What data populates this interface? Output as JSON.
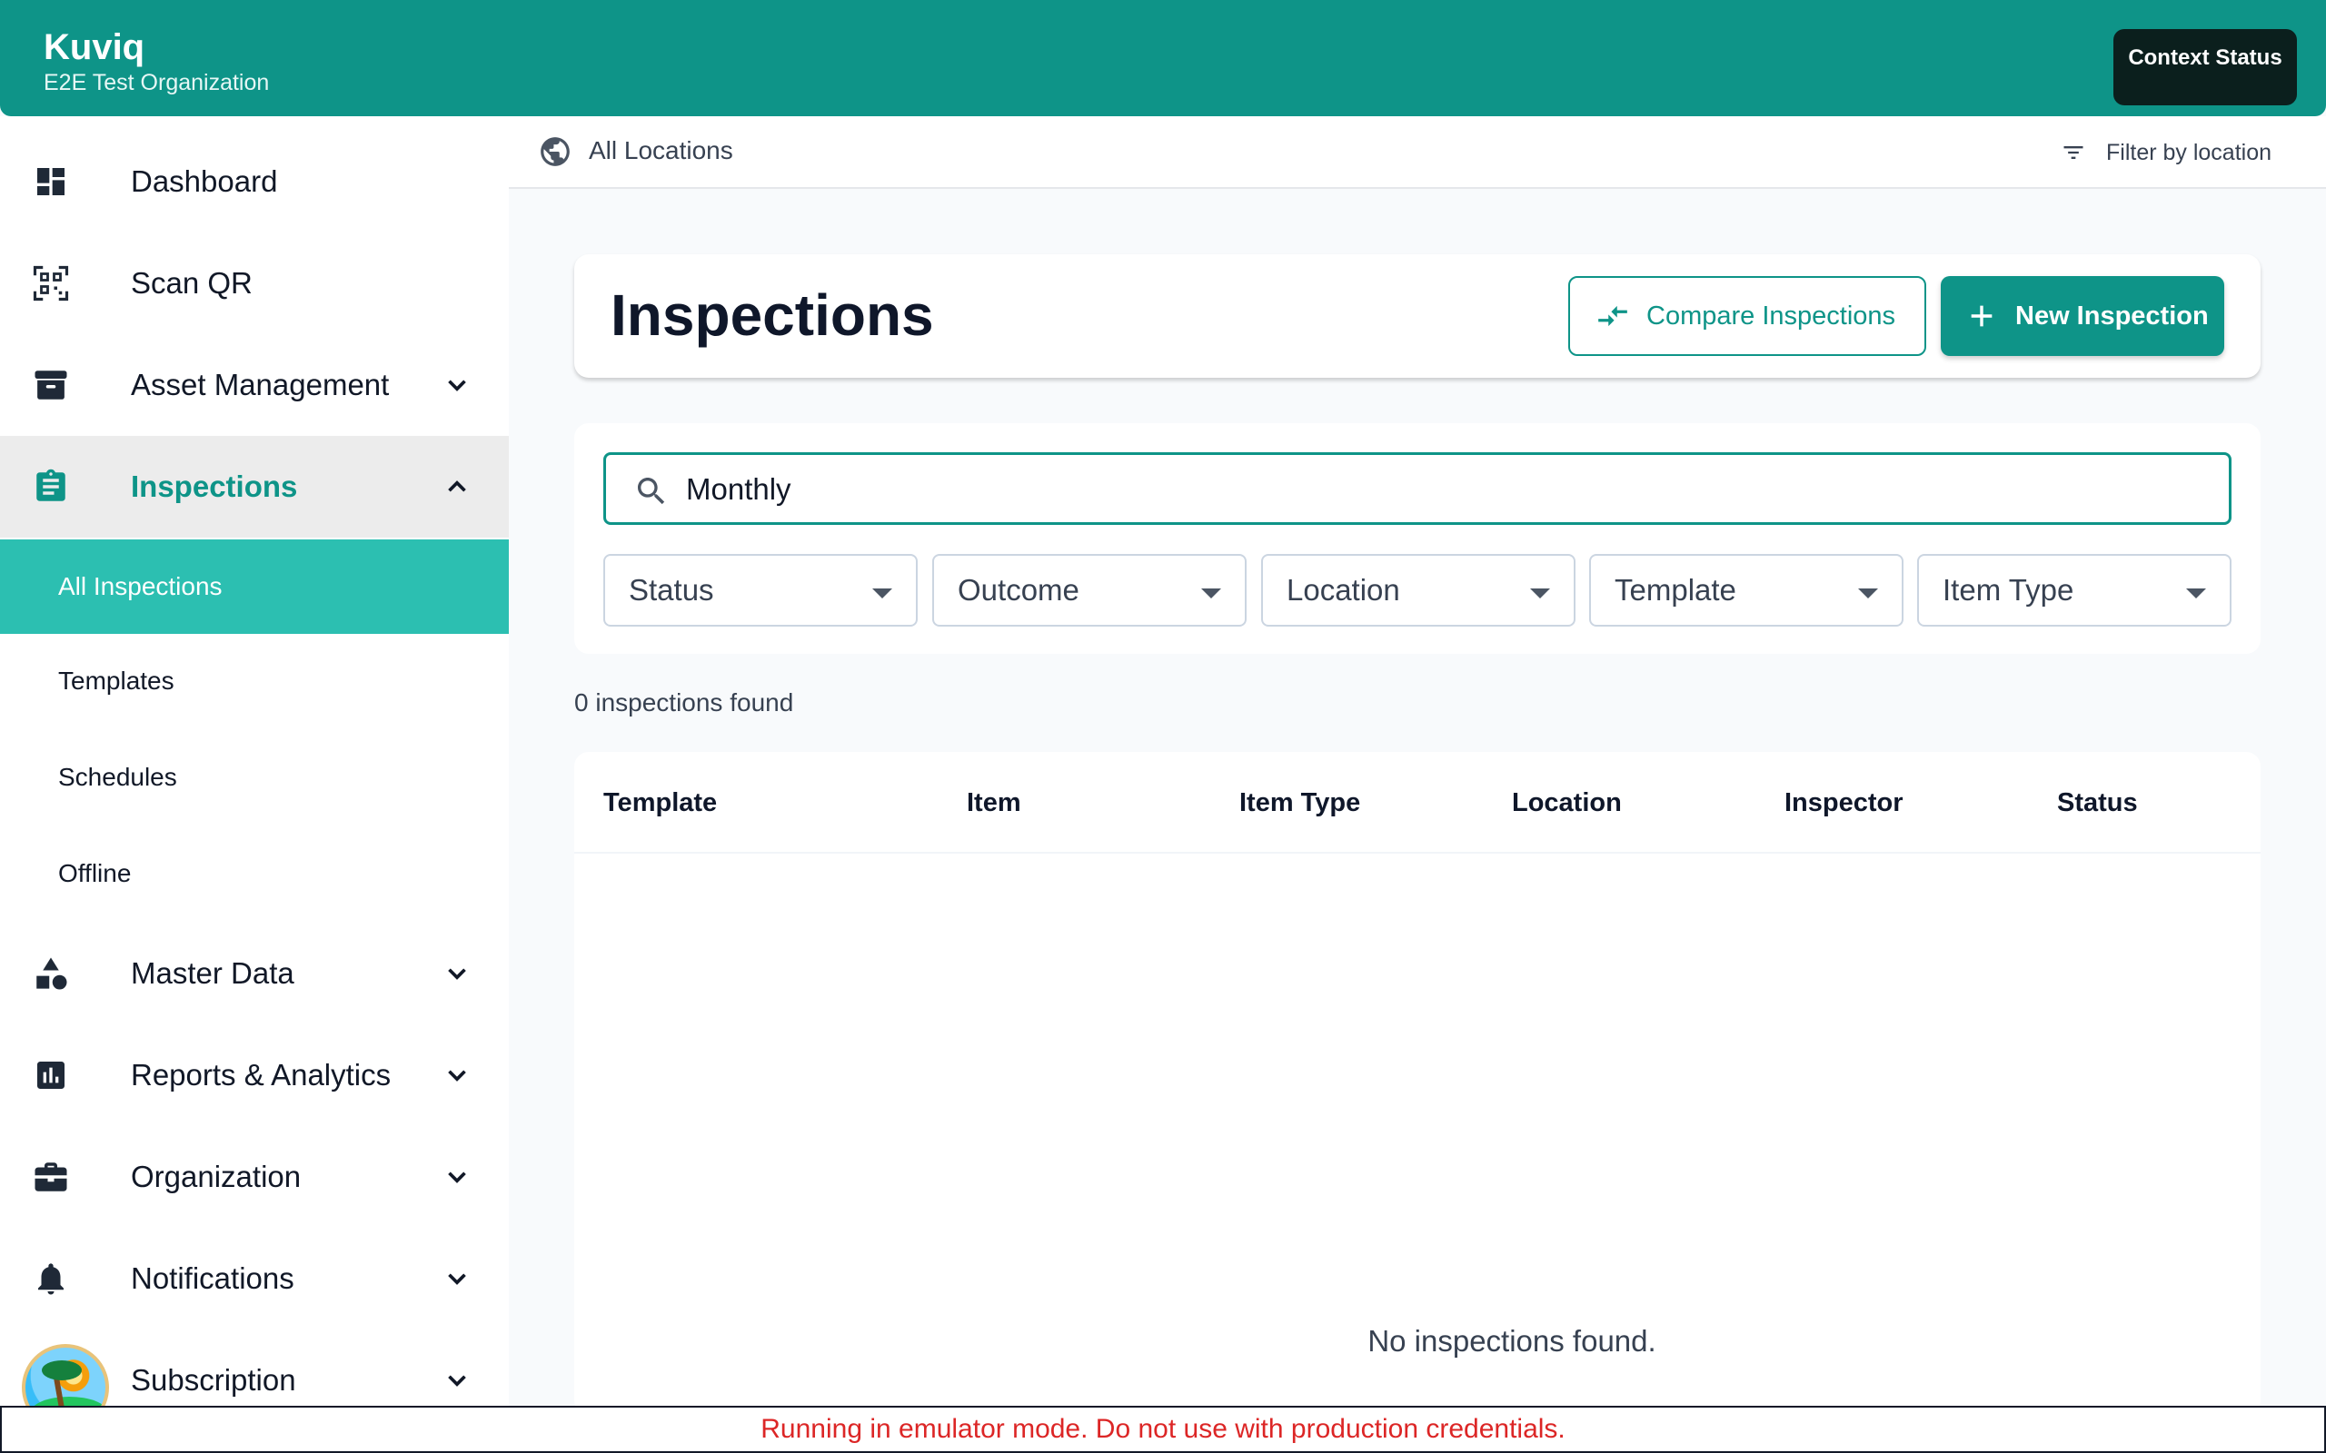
{
  "header": {
    "app_title": "Kuviq",
    "org_name": "E2E Test Organization",
    "context_button": "Context Status",
    "brand_color": "#0e9488"
  },
  "sidebar": {
    "items": [
      {
        "label": "Dashboard",
        "icon": "dashboard-icon"
      },
      {
        "label": "Scan QR",
        "icon": "qr-code-icon"
      },
      {
        "label": "Asset Management",
        "icon": "archive-icon"
      },
      {
        "label": "Inspections",
        "icon": "clipboard-icon",
        "active": true
      },
      {
        "label": "Master Data",
        "icon": "shapes-icon"
      },
      {
        "label": "Reports & Analytics",
        "icon": "bar-chart-icon"
      },
      {
        "label": "Organization",
        "icon": "briefcase-icon"
      },
      {
        "label": "Notifications",
        "icon": "bell-icon"
      },
      {
        "label": "Subscription",
        "icon": "card-icon"
      }
    ],
    "sub_items": [
      {
        "label": "All Inspections",
        "selected": true
      },
      {
        "label": "Templates"
      },
      {
        "label": "Schedules"
      },
      {
        "label": "Offline"
      }
    ]
  },
  "location_bar": {
    "label": "All Locations",
    "filter_label": "Filter by location"
  },
  "page": {
    "title": "Inspections",
    "compare_button": "Compare Inspections",
    "new_button": "New Inspection"
  },
  "filters": {
    "search_value": "Monthly",
    "selects": [
      "Status",
      "Outcome",
      "Location",
      "Template",
      "Item Type"
    ]
  },
  "results": {
    "count_text": "0 inspections found",
    "columns": [
      "Template",
      "Item",
      "Item Type",
      "Location",
      "Inspector",
      "Status"
    ],
    "empty_message": "No inspections found."
  },
  "banner": {
    "text": "Running in emulator mode. Do not use with production credentials."
  }
}
